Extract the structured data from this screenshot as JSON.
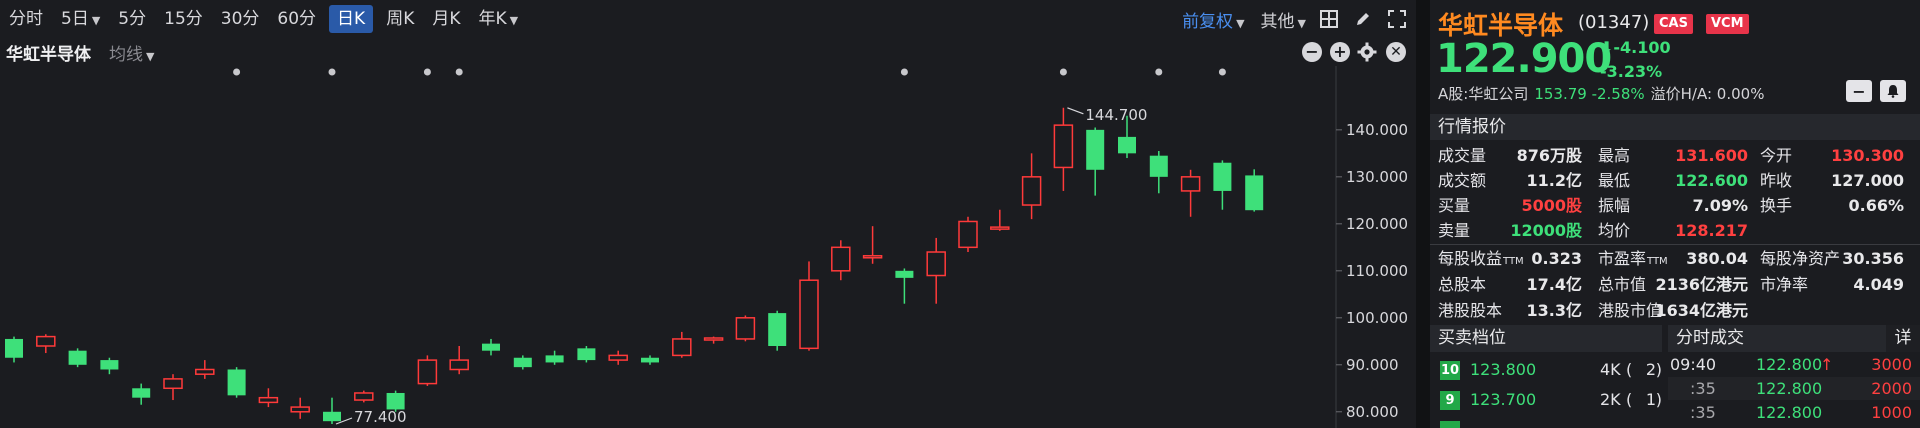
{
  "toolbar": {
    "periods": [
      "分时",
      "5日",
      "5分",
      "15分",
      "30分",
      "60分",
      "日K",
      "周K",
      "月K",
      "年K"
    ],
    "active_period": "日K",
    "adjust_label": "前复权",
    "more_label": "其他",
    "icons": [
      "layout-icon",
      "pencil-icon",
      "fullscreen-icon"
    ]
  },
  "chart_header": {
    "stock_name": "华虹半导体",
    "ma_label": "均线",
    "buttons": [
      "minus-icon",
      "plus-icon",
      "gear-icon",
      "close-icon"
    ]
  },
  "chart_data": {
    "type": "candlestick",
    "ylim": [
      77.4,
      145.5
    ],
    "y_ticks": [
      "140.000",
      "130.000",
      "120.000",
      "110.000",
      "100.000",
      "90.000",
      "80.000"
    ],
    "y_tick_values": [
      140,
      130,
      120,
      110,
      100,
      90,
      80
    ],
    "annotations": {
      "high": "144.700",
      "low": "77.400"
    },
    "up_color": "#ff3a3a",
    "down_color": "#3ee07a",
    "candles": [
      {
        "o": 95.5,
        "c": 91.5,
        "h": 96.0,
        "l": 90.5
      },
      {
        "o": 94.0,
        "c": 96.0,
        "h": 96.5,
        "l": 92.5
      },
      {
        "o": 93.0,
        "c": 90.0,
        "h": 93.5,
        "l": 89.5
      },
      {
        "o": 91.0,
        "c": 89.0,
        "h": 91.5,
        "l": 88.0
      },
      {
        "o": 85.0,
        "c": 83.0,
        "h": 86.0,
        "l": 81.5
      },
      {
        "o": 85.0,
        "c": 87.0,
        "h": 88.0,
        "l": 82.5
      },
      {
        "o": 88.0,
        "c": 89.0,
        "h": 91.0,
        "l": 87.0
      },
      {
        "o": 89.0,
        "c": 83.5,
        "h": 89.5,
        "l": 83.0
      },
      {
        "o": 82.0,
        "c": 83.0,
        "h": 85.0,
        "l": 81.0
      },
      {
        "o": 80.0,
        "c": 81.0,
        "h": 83.0,
        "l": 78.5
      },
      {
        "o": 80.0,
        "c": 78.0,
        "h": 83.0,
        "l": 77.4
      },
      {
        "o": 82.5,
        "c": 84.0,
        "h": 84.5,
        "l": 82.0
      },
      {
        "o": 84.0,
        "c": 80.5,
        "h": 84.5,
        "l": 80.0
      },
      {
        "o": 86.0,
        "c": 91.0,
        "h": 92.0,
        "l": 85.5
      },
      {
        "o": 89.0,
        "c": 91.0,
        "h": 94.0,
        "l": 88.0
      },
      {
        "o": 94.5,
        "c": 93.0,
        "h": 95.5,
        "l": 92.0
      },
      {
        "o": 91.5,
        "c": 89.5,
        "h": 92.0,
        "l": 89.0
      },
      {
        "o": 92.0,
        "c": 90.5,
        "h": 93.0,
        "l": 90.0
      },
      {
        "o": 93.5,
        "c": 91.0,
        "h": 94.0,
        "l": 90.5
      },
      {
        "o": 91.0,
        "c": 92.0,
        "h": 93.0,
        "l": 90.0
      },
      {
        "o": 91.5,
        "c": 90.5,
        "h": 92.0,
        "l": 90.0
      },
      {
        "o": 92.0,
        "c": 95.5,
        "h": 97.0,
        "l": 91.5
      },
      {
        "o": 95.5,
        "c": 95.7,
        "h": 96.0,
        "l": 94.5
      },
      {
        "o": 95.5,
        "c": 100.0,
        "h": 100.5,
        "l": 95.0
      },
      {
        "o": 101.0,
        "c": 94.0,
        "h": 101.5,
        "l": 93.0
      },
      {
        "o": 93.5,
        "c": 108.0,
        "h": 112.0,
        "l": 93.0
      },
      {
        "o": 110.0,
        "c": 115.0,
        "h": 116.5,
        "l": 108.0
      },
      {
        "o": 113.0,
        "c": 113.2,
        "h": 119.5,
        "l": 111.5
      },
      {
        "o": 110.0,
        "c": 108.5,
        "h": 110.5,
        "l": 103.0
      },
      {
        "o": 109.0,
        "c": 114.0,
        "h": 117.0,
        "l": 103.0
      },
      {
        "o": 115.0,
        "c": 120.5,
        "h": 121.5,
        "l": 114.0
      },
      {
        "o": 119.0,
        "c": 119.3,
        "h": 123.0,
        "l": 118.5
      },
      {
        "o": 124.0,
        "c": 130.0,
        "h": 135.0,
        "l": 121.0
      },
      {
        "o": 132.0,
        "c": 141.0,
        "h": 144.7,
        "l": 127.0
      },
      {
        "o": 140.0,
        "c": 131.5,
        "h": 140.5,
        "l": 126.0
      },
      {
        "o": 138.5,
        "c": 135.0,
        "h": 143.0,
        "l": 134.0
      },
      {
        "o": 134.5,
        "c": 130.0,
        "h": 135.5,
        "l": 126.5
      },
      {
        "o": 127.0,
        "c": 130.0,
        "h": 131.5,
        "l": 121.5
      },
      {
        "o": 133.0,
        "c": 127.0,
        "h": 133.5,
        "l": 123.0
      },
      {
        "o": 130.3,
        "c": 122.9,
        "h": 131.6,
        "l": 122.6
      }
    ]
  },
  "quote": {
    "name": "华虹半导体",
    "code": "(01347)",
    "badges": [
      "CAS",
      "VCM"
    ],
    "price": "122.900",
    "change": "-4.100",
    "change_pct": "-3.23%",
    "a_share_label": "A股:华虹公司",
    "a_share_value": "153.79 -2.58%",
    "premium": "溢价H/A: 0.00%",
    "market_quote_title": "行情报价",
    "stats": [
      [
        {
          "label": "成交量",
          "value": "876万股",
          "color": "white"
        },
        {
          "label": "最高",
          "value": "131.600",
          "color": "red"
        },
        {
          "label": "今开",
          "value": "130.300",
          "color": "red"
        }
      ],
      [
        {
          "label": "成交额",
          "value": "11.2亿",
          "color": "white"
        },
        {
          "label": "最低",
          "value": "122.600",
          "color": "green"
        },
        {
          "label": "昨收",
          "value": "127.000",
          "color": "white"
        }
      ],
      [
        {
          "label": "买量",
          "value": "5000股",
          "color": "red"
        },
        {
          "label": "振幅",
          "value": "7.09%",
          "color": "white"
        },
        {
          "label": "换手",
          "value": "0.66%",
          "color": "white"
        }
      ],
      [
        {
          "label": "卖量",
          "value": "12000股",
          "color": "green"
        },
        {
          "label": "均价",
          "value": "128.217",
          "color": "red"
        },
        {
          "label": "",
          "value": "",
          "color": "white"
        }
      ]
    ],
    "fundamentals": [
      [
        {
          "label": "每股收益",
          "sub": "TTM",
          "value": "0.323"
        },
        {
          "label": "市盈率",
          "sub": "TTM",
          "value": "380.04"
        },
        {
          "label": "每股净资产",
          "sub": "",
          "value": "30.356"
        }
      ],
      [
        {
          "label": "总股本",
          "sub": "",
          "value": "17.4亿"
        },
        {
          "label": "总市值",
          "sub": "",
          "value": "2136亿港元"
        },
        {
          "label": "市净率",
          "sub": "",
          "value": "4.049"
        }
      ],
      [
        {
          "label": "港股股本",
          "sub": "",
          "value": "13.3亿"
        },
        {
          "label": "港股市值",
          "sub": "",
          "value": "1634亿港元"
        },
        {
          "label": "",
          "sub": "",
          "value": ""
        }
      ]
    ],
    "order_book_title": "买卖档位",
    "order_book": [
      {
        "level": "10",
        "price": "123.800",
        "qty": "4K",
        "orders": "2"
      },
      {
        "level": "9",
        "price": "123.700",
        "qty": "2K",
        "orders": "1"
      }
    ],
    "ticks_title": "分时成交",
    "ticks_detail": "详",
    "ticks": [
      {
        "time": "09:40",
        "price": "122.800",
        "arrow": "↑",
        "vol": "3000"
      },
      {
        "time": ":35",
        "price": "122.800",
        "arrow": "",
        "vol": "2000"
      },
      {
        "time": ":35",
        "price": "122.800",
        "arrow": "",
        "vol": "1000"
      }
    ]
  }
}
